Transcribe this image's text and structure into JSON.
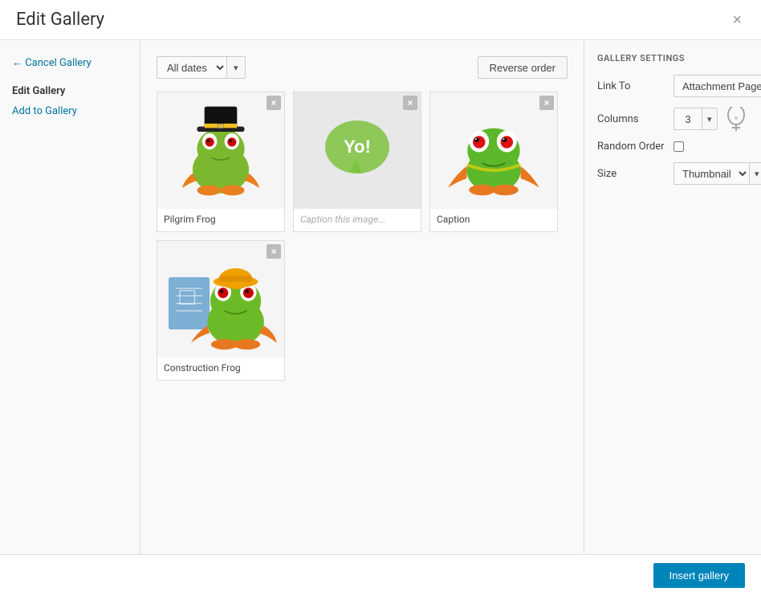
{
  "modal": {
    "title": "Edit Gallery",
    "close_label": "×"
  },
  "sidebar": {
    "cancel_label": "← Cancel Gallery",
    "section_title": "Edit Gallery",
    "add_to_gallery_label": "Add to Gallery"
  },
  "toolbar": {
    "date_filter_value": "All dates",
    "date_dropdown_arrow": "▾",
    "reverse_order_label": "Reverse order"
  },
  "gallery": {
    "items": [
      {
        "id": "pilgrim-frog",
        "caption": "Pilgrim Frog",
        "caption_placeholder": false
      },
      {
        "id": "yo-frog",
        "caption": "Caption this image...",
        "caption_placeholder": true
      },
      {
        "id": "red-frog",
        "caption": "Caption",
        "caption_placeholder": false
      },
      {
        "id": "construction-frog",
        "caption": "Construction Frog",
        "caption_placeholder": false
      }
    ]
  },
  "settings": {
    "title": "GALLERY SETTINGS",
    "link_to_label": "Link To",
    "link_to_value": "Attachment Page",
    "link_to_arrow": "▾",
    "columns_label": "Columns",
    "columns_value": "3",
    "columns_arrow": "▾",
    "random_order_label": "Random Order",
    "size_label": "Size",
    "size_value": "Thumbnail",
    "size_arrow": "▾"
  },
  "footer": {
    "insert_gallery_label": "Insert gallery"
  }
}
